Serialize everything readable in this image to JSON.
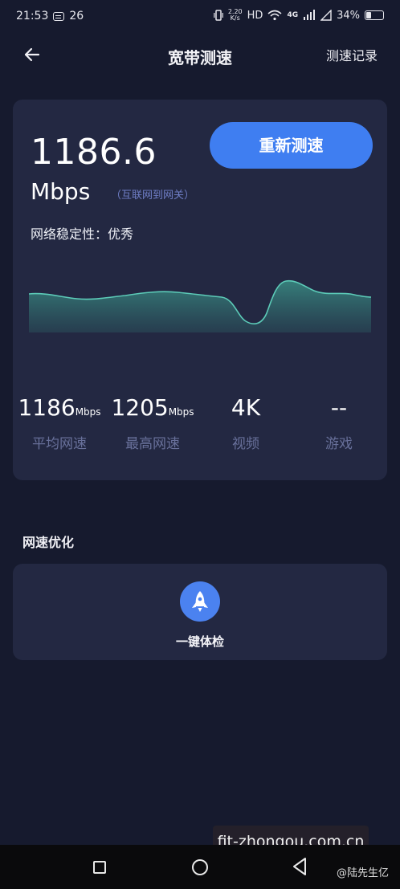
{
  "status_bar": {
    "time": "21:53",
    "notif_count": "26",
    "net_speed_value": "2.20",
    "net_speed_unit": "K/s",
    "hd": "HD",
    "net_type": "4G",
    "battery": "34%",
    "battery_level": 0.34
  },
  "header": {
    "title": "宽带测速",
    "records": "测速记录"
  },
  "result": {
    "speed": "1186.6",
    "unit": "Mbps",
    "note": "（互联网到网关）",
    "retest_label": "重新测速",
    "stability": "网络稳定性：优秀"
  },
  "stats": [
    {
      "value": "1186",
      "unit": "Mbps",
      "label": "平均网速"
    },
    {
      "value": "1205",
      "unit": "Mbps",
      "label": "最高网速"
    },
    {
      "value": "4K",
      "unit": "",
      "label": "视频"
    },
    {
      "value": "--",
      "unit": "",
      "label": "游戏"
    }
  ],
  "optimize": {
    "section_title": "网速优化",
    "one_key": "一键体检"
  },
  "watermark": "fit-zhongou.com.cn",
  "credit": "@陆先生亿",
  "colors": {
    "background": "#161a2e",
    "card": "#232842",
    "accent": "#3f7ef1",
    "chart_line": "#5ccbb8"
  }
}
